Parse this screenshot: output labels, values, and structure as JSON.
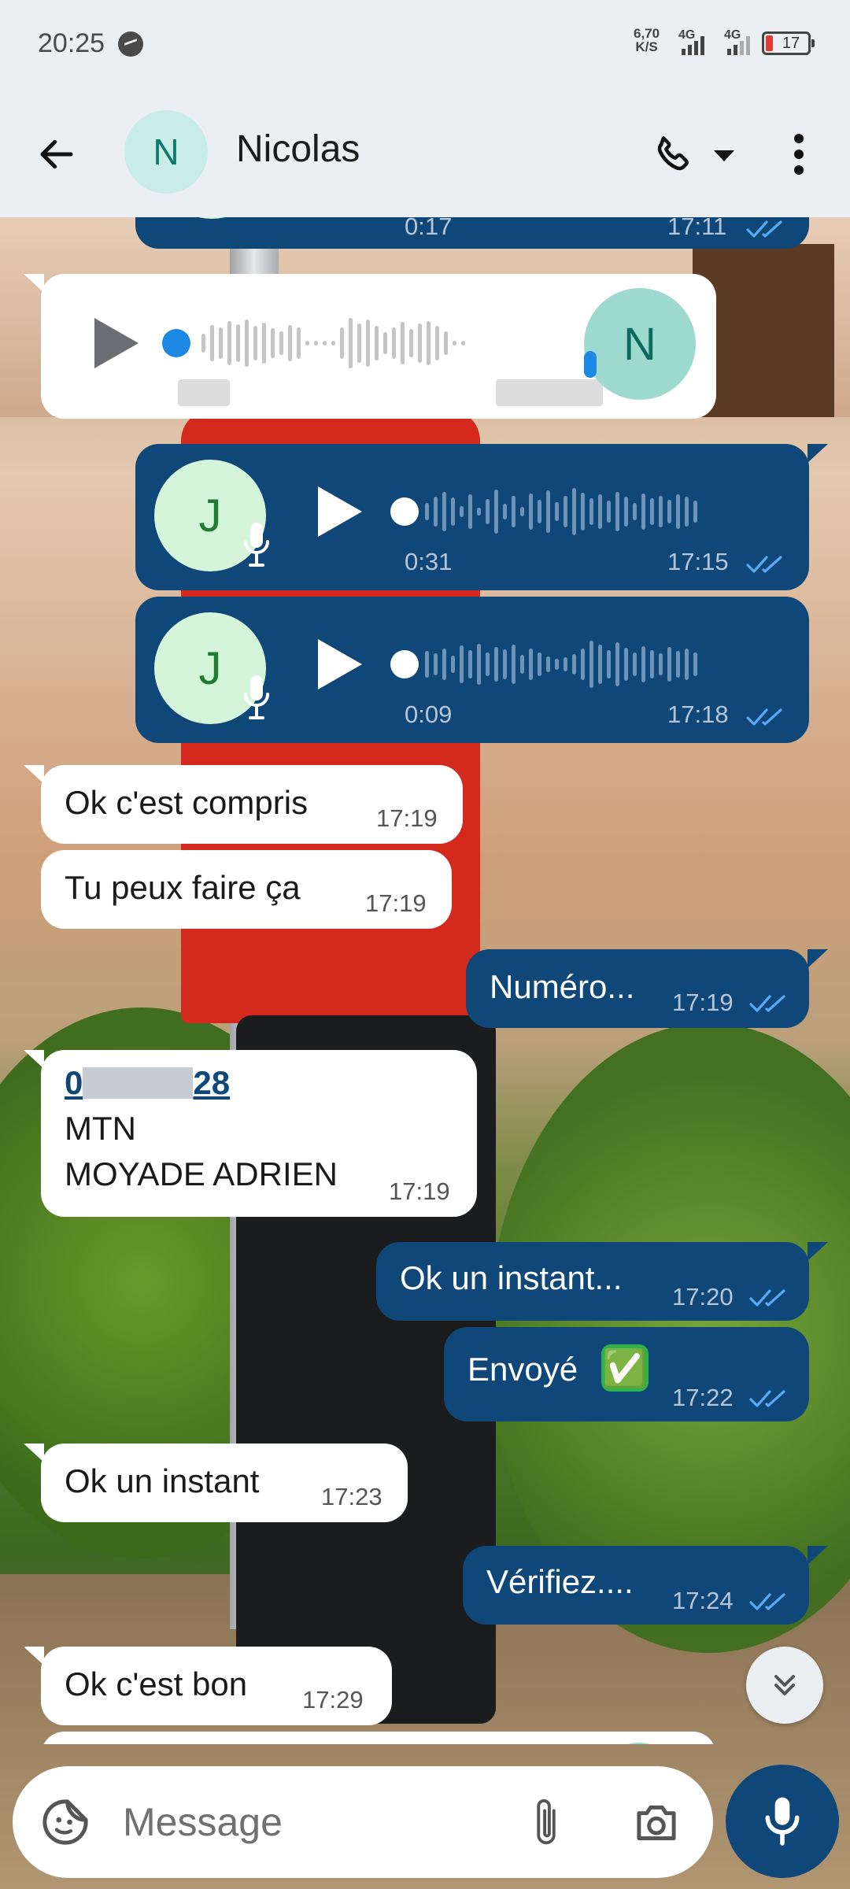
{
  "status_bar": {
    "time": "20:25",
    "net_speed_value": "6,70",
    "net_speed_unit": "K/S",
    "network_1": "4G",
    "network_2": "4G",
    "battery": "17"
  },
  "header": {
    "avatar_initial": "N",
    "contact_name": "Nicolas"
  },
  "colors": {
    "outgoing_bubble": "#0e4778",
    "incoming_bubble": "#ffffff",
    "header_bg": "#eceff1",
    "tick_read": "#5aa9f5"
  },
  "messages": {
    "voice_top": {
      "duration": "0:17",
      "time": "17:11"
    },
    "voice_in": {
      "avatar_initial": "N"
    },
    "voice_out_1": {
      "avatar_initial": "J",
      "duration": "0:31",
      "time": "17:15"
    },
    "voice_out_2": {
      "avatar_initial": "J",
      "duration": "0:09",
      "time": "17:18"
    },
    "m1": {
      "text": "Ok c'est compris",
      "time": "17:19"
    },
    "m2": {
      "text": "Tu peux faire ça",
      "time": "17:19"
    },
    "m3": {
      "text": "Numéro...",
      "time": "17:19"
    },
    "m4": {
      "link_start": "0",
      "link_end": "28",
      "line2": "MTN",
      "line3": "MOYADE ADRIEN",
      "time": "17:19"
    },
    "m5": {
      "text": "Ok un instant...",
      "time": "17:20"
    },
    "m6": {
      "text": "Envoyé",
      "emoji": "✅",
      "time": "17:22"
    },
    "m7": {
      "text": "Ok un instant",
      "time": "17:23"
    },
    "m8": {
      "text": "Vérifiez....",
      "time": "17:24"
    },
    "m9": {
      "text": "Ok c'est bon",
      "time": "17:29"
    }
  },
  "composer": {
    "placeholder": "Message"
  },
  "icons": {
    "back": "arrow-left-icon",
    "call": "phone-icon",
    "call_dropdown": "caret-down-icon",
    "menu": "more-vertical-icon",
    "emoji": "sticker-icon",
    "attach": "paperclip-icon",
    "camera": "camera-icon",
    "mic": "mic-icon",
    "scroll_down": "double-chevron-down-icon"
  }
}
